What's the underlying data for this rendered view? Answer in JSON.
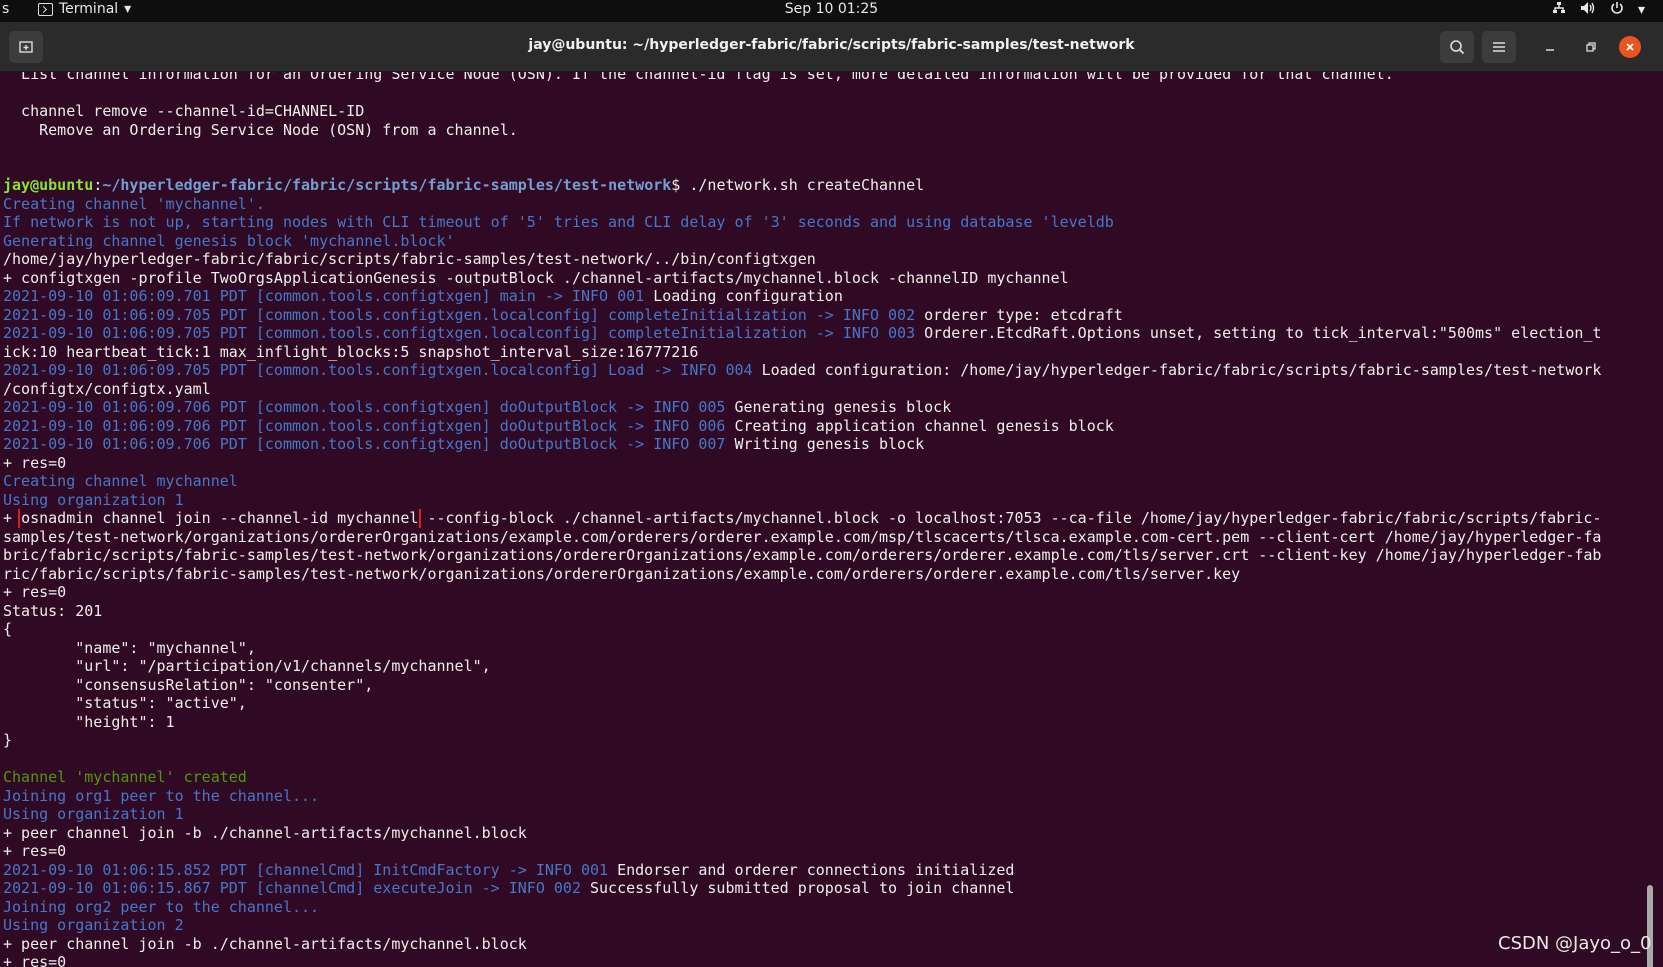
{
  "topbar": {
    "edge_char": "s",
    "app_name": "Terminal",
    "app_menu_arrow": "▾",
    "clock": "Sep 10  01:25",
    "tray": {
      "network": "network-icon",
      "volume": "volume-icon",
      "power": "power-icon",
      "menu_arrow": "▾"
    }
  },
  "window": {
    "title": "jay@ubuntu: ~/hyperledger-fabric/fabric/scripts/fabric-samples/test-network",
    "close_color": "#e95420"
  },
  "terminal": {
    "lines": [
      {
        "c": "",
        "t": "  List channel information for an Ordering Service Node (OSN). If the channel-id flag is set, more detailed information will be provided for that channel."
      },
      {
        "c": "",
        "t": ""
      },
      {
        "c": "",
        "t": "  channel remove --channel-id=CHANNEL-ID"
      },
      {
        "c": "",
        "t": "    Remove an Ordering Service Node (OSN) from a channel."
      },
      {
        "c": "",
        "t": ""
      },
      {
        "c": "",
        "t": ""
      },
      {
        "c": "prompt",
        "user": "jay@ubuntu",
        "path": "~/hyperledger-fabric/fabric/scripts/fabric-samples/test-network",
        "cmd": "$ ./network.sh createChannel"
      },
      {
        "c": "blue",
        "t": "Creating channel 'mychannel'."
      },
      {
        "c": "blue",
        "t": "If network is not up, starting nodes with CLI timeout of '5' tries and CLI delay of '3' seconds and using database 'leveldb"
      },
      {
        "c": "blue",
        "t": "Generating channel genesis block 'mychannel.block'"
      },
      {
        "c": "",
        "t": "/home/jay/hyperledger-fabric/fabric/scripts/fabric-samples/test-network/../bin/configtxgen"
      },
      {
        "c": "",
        "t": "+ configtxgen -profile TwoOrgsApplicationGenesis -outputBlock ./channel-artifacts/mychannel.block -channelID mychannel"
      },
      {
        "c": "log",
        "b": "2021-09-10 01:06:09.701 PDT [common.tools.configtxgen] main -> INFO 001",
        "w": " Loading configuration"
      },
      {
        "c": "log",
        "b": "2021-09-10 01:06:09.705 PDT [common.tools.configtxgen.localconfig] completeInitialization -> INFO 002",
        "w": " orderer type: etcdraft"
      },
      {
        "c": "log",
        "b": "2021-09-10 01:06:09.705 PDT [common.tools.configtxgen.localconfig] completeInitialization -> INFO 003",
        "w": " Orderer.EtcdRaft.Options unset, setting to tick_interval:\"500ms\" election_t"
      },
      {
        "c": "",
        "t": "ick:10 heartbeat_tick:1 max_inflight_blocks:5 snapshot_interval_size:16777216"
      },
      {
        "c": "log",
        "b": "2021-09-10 01:06:09.705 PDT [common.tools.configtxgen.localconfig] Load -> INFO 004",
        "w": " Loaded configuration: /home/jay/hyperledger-fabric/fabric/scripts/fabric-samples/test-network"
      },
      {
        "c": "",
        "t": "/configtx/configtx.yaml"
      },
      {
        "c": "log",
        "b": "2021-09-10 01:06:09.706 PDT [common.tools.configtxgen] doOutputBlock -> INFO 005",
        "w": " Generating genesis block"
      },
      {
        "c": "log",
        "b": "2021-09-10 01:06:09.706 PDT [common.tools.configtxgen] doOutputBlock -> INFO 006",
        "w": " Creating application channel genesis block"
      },
      {
        "c": "log",
        "b": "2021-09-10 01:06:09.706 PDT [common.tools.configtxgen] doOutputBlock -> INFO 007",
        "w": " Writing genesis block"
      },
      {
        "c": "",
        "t": "+ res=0"
      },
      {
        "c": "blue",
        "t": "Creating channel mychannel"
      },
      {
        "c": "blue",
        "t": "Using organization 1"
      },
      {
        "c": "hl",
        "pre": "+ ",
        "h": "osnadmin channel join --channel-id mychannel",
        "post": " --config-block ./channel-artifacts/mychannel.block -o localhost:7053 --ca-file /home/jay/hyperledger-fabric/fabric/scripts/fabric-"
      },
      {
        "c": "",
        "t": "samples/test-network/organizations/ordererOrganizations/example.com/orderers/orderer.example.com/msp/tlscacerts/tlsca.example.com-cert.pem --client-cert /home/jay/hyperledger-fa"
      },
      {
        "c": "",
        "t": "bric/fabric/scripts/fabric-samples/test-network/organizations/ordererOrganizations/example.com/orderers/orderer.example.com/tls/server.crt --client-key /home/jay/hyperledger-fab"
      },
      {
        "c": "",
        "t": "ric/fabric/scripts/fabric-samples/test-network/organizations/ordererOrganizations/example.com/orderers/orderer.example.com/tls/server.key"
      },
      {
        "c": "",
        "t": "+ res=0"
      },
      {
        "c": "",
        "t": "Status: 201"
      },
      {
        "c": "",
        "t": "{"
      },
      {
        "c": "",
        "t": "        \"name\": \"mychannel\","
      },
      {
        "c": "",
        "t": "        \"url\": \"/participation/v1/channels/mychannel\","
      },
      {
        "c": "",
        "t": "        \"consensusRelation\": \"consenter\","
      },
      {
        "c": "",
        "t": "        \"status\": \"active\","
      },
      {
        "c": "",
        "t": "        \"height\": 1"
      },
      {
        "c": "",
        "t": "}"
      },
      {
        "c": "",
        "t": ""
      },
      {
        "c": "green",
        "t": "Channel 'mychannel' created"
      },
      {
        "c": "blue",
        "t": "Joining org1 peer to the channel..."
      },
      {
        "c": "blue",
        "t": "Using organization 1"
      },
      {
        "c": "",
        "t": "+ peer channel join -b ./channel-artifacts/mychannel.block"
      },
      {
        "c": "",
        "t": "+ res=0"
      },
      {
        "c": "log",
        "b": "2021-09-10 01:06:15.852 PDT [channelCmd] InitCmdFactory -> INFO 001",
        "w": " Endorser and orderer connections initialized"
      },
      {
        "c": "log",
        "b": "2021-09-10 01:06:15.867 PDT [channelCmd] executeJoin -> INFO 002",
        "w": " Successfully submitted proposal to join channel"
      },
      {
        "c": "blue",
        "t": "Joining org2 peer to the channel..."
      },
      {
        "c": "blue",
        "t": "Using organization 2"
      },
      {
        "c": "",
        "t": "+ peer channel join -b ./channel-artifacts/mychannel.block"
      },
      {
        "c": "",
        "t": "+ res=0"
      }
    ],
    "colors": {
      "background": "#300a24",
      "text": "#eeeeec",
      "info": "#4777c9",
      "success": "#4e9a06",
      "highlight": "#e01b1b"
    }
  },
  "watermark": "CSDN @Jayo_o_0"
}
